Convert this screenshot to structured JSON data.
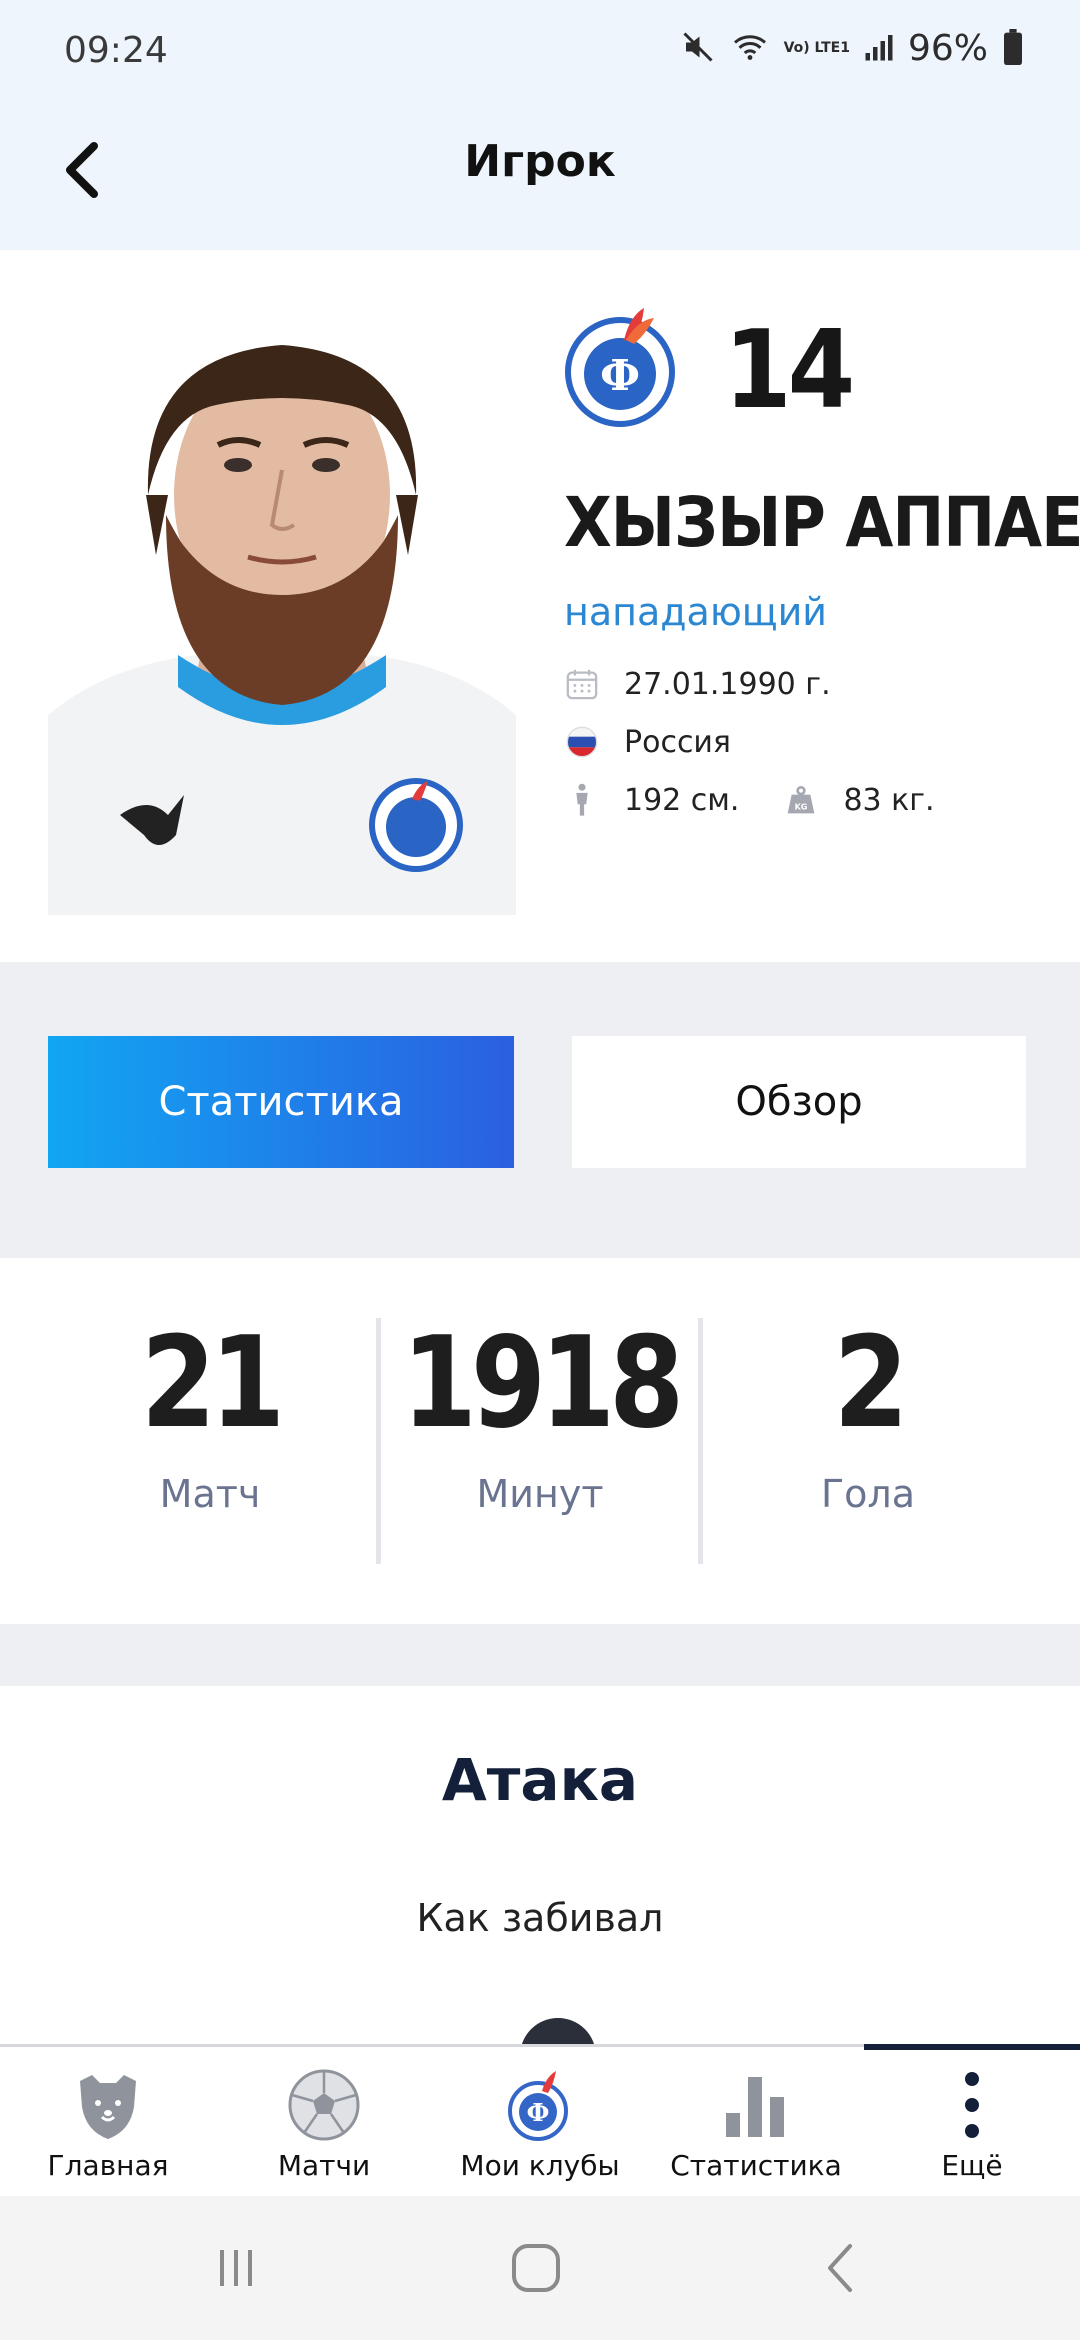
{
  "status_bar": {
    "time": "09:24",
    "network": "Vo) LTE1",
    "battery": "96%"
  },
  "header": {
    "title": "Игрок"
  },
  "player": {
    "number": "14",
    "name": "ХЫЗЫР АППАЕВ",
    "position": "нападающий",
    "birth_date": "27.01.1990 г.",
    "country": "Россия",
    "height": "192 см.",
    "weight": "83 кг."
  },
  "tabs": [
    {
      "label": "Статистика",
      "active": true
    },
    {
      "label": "Обзор",
      "active": false
    }
  ],
  "summary": [
    {
      "value": "21",
      "label": "Матч"
    },
    {
      "value": "1918",
      "label": "Минут"
    },
    {
      "value": "2",
      "label": "Гола"
    }
  ],
  "attack": {
    "title": "Атака",
    "subtitle": "Как забивал"
  },
  "bottom_nav": [
    {
      "label": "Главная",
      "icon": "bear-logo-icon"
    },
    {
      "label": "Матчи",
      "icon": "soccer-ball-icon"
    },
    {
      "label": "Мои клубы",
      "icon": "club-logo-icon"
    },
    {
      "label": "Статистика",
      "icon": "bar-chart-icon"
    },
    {
      "label": "Ещё",
      "icon": "more-vertical-icon",
      "active": true
    }
  ],
  "colors": {
    "accent": "#2b87d1",
    "tab_gradient_start": "#11a6f3",
    "tab_gradient_end": "#2b5fe0",
    "header_bg": "#eef5fd",
    "section_bg": "#eeeff3"
  }
}
